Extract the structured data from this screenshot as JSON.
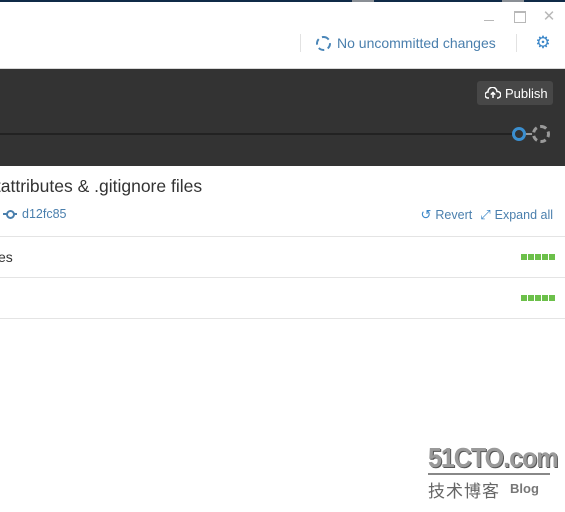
{
  "window": {
    "controls": {
      "minimize": "_",
      "maximize": "□",
      "close": "✕"
    }
  },
  "header": {
    "status_text": "No uncommitted changes",
    "status_icon": "dashed-circle-icon",
    "settings_icon": "gear-icon",
    "settings_glyph": "⚙"
  },
  "toolbar": {
    "publish_label": "Publish",
    "publish_icon": "cloud-upload-icon"
  },
  "commit": {
    "title": "itattributes & .gitignore files",
    "sha": "d12fc85",
    "revert_label": "Revert",
    "revert_glyph": "↺",
    "expand_label": "Expand all",
    "expand_glyph": "⤢"
  },
  "files": [
    {
      "name": "es",
      "additions_blocks": 5
    },
    {
      "name": "",
      "additions_blocks": 5
    }
  ],
  "colors": {
    "accent": "#3b8fd0",
    "link": "#4a7fad",
    "toolbar_bg": "#333333",
    "diff_added": "#6cc04a"
  },
  "watermark": {
    "top": "51CTO.com",
    "cn": "技术博客",
    "blog": "Blog"
  }
}
